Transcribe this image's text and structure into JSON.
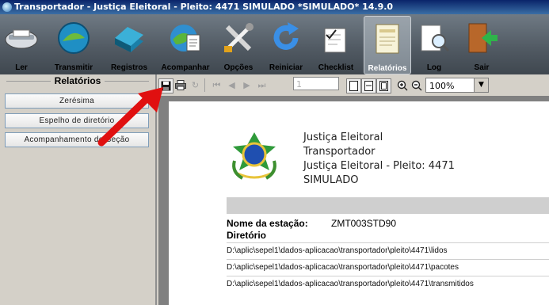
{
  "window": {
    "title": "Transportador - Justiça Eleitoral - Pleito: 4471 SIMULADO *SIMULADO* 14.9.0"
  },
  "toolbar": [
    {
      "id": "ler",
      "label": "Ler",
      "icon": "scanner-icon"
    },
    {
      "id": "transmitir",
      "label": "Transmitir",
      "icon": "satellite-dish-icon"
    },
    {
      "id": "registros",
      "label": "Registros",
      "icon": "books-icon"
    },
    {
      "id": "acompanhar",
      "label": "Acompanhar",
      "icon": "globe-document-icon"
    },
    {
      "id": "opcoes",
      "label": "Opções",
      "icon": "tools-icon"
    },
    {
      "id": "reiniciar",
      "label": "Reiniciar",
      "icon": "refresh-icon"
    },
    {
      "id": "checklist",
      "label": "Checklist",
      "icon": "checklist-icon"
    },
    {
      "id": "relatorios",
      "label": "Relatórios",
      "icon": "report-icon",
      "active": true
    },
    {
      "id": "log",
      "label": "Log",
      "icon": "magnifier-page-icon"
    },
    {
      "id": "sair",
      "label": "Sair",
      "icon": "exit-door-icon"
    }
  ],
  "left_panel": {
    "title": "Relatórios",
    "buttons": [
      "Zerésima",
      "Espelho de diretório",
      "Acompanhamento de Seção"
    ]
  },
  "report_toolbar": {
    "page_value": "1",
    "zoom": "100%"
  },
  "document": {
    "header_lines": [
      "Justiça Eleitoral",
      "Transportador",
      "Justiça Eleitoral - Pleito: 4471",
      "SIMULADO"
    ],
    "station_label": "Nome da estação:",
    "station_value": "ZMT003STD90",
    "directory_label": "Diretório",
    "directories": [
      "D:\\aplic\\sepel1\\dados-aplicacao\\transportador\\pleito\\4471\\lidos",
      "D:\\aplic\\sepel1\\dados-aplicacao\\transportador\\pleito\\4471\\pacotes",
      "D:\\aplic\\sepel1\\dados-aplicacao\\transportador\\pleito\\4471\\transmitidos"
    ]
  },
  "colors": {
    "arrow": "#e01010",
    "toolbar_top": "#6f7a84",
    "titlebar": "#0a246a"
  }
}
